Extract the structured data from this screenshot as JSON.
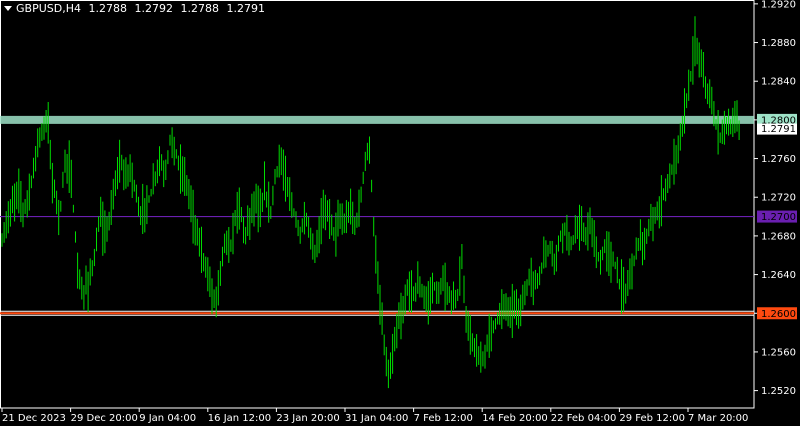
{
  "header": {
    "symbol_tf": "GBPUSD,H4",
    "open": "1.2788",
    "high": "1.2792",
    "low": "1.2788",
    "close": "1.2791"
  },
  "chart_data": {
    "type": "bar",
    "x_ticks": [
      "21 Dec 2023",
      "29 Dec 20:00",
      "9 Jan 04:00",
      "16 Jan 12:00",
      "23 Jan 20:00",
      "31 Jan 04:00",
      "7 Feb 12:00",
      "14 Feb 20:00",
      "22 Feb 04:00",
      "29 Feb 12:00",
      "7 Mar 20:00"
    ],
    "y_ticks": [
      1.292,
      1.288,
      1.284,
      1.28,
      1.276,
      1.272,
      1.268,
      1.264,
      1.26,
      1.256,
      1.252
    ],
    "ylim": [
      1.2502,
      1.2924
    ],
    "grid": false,
    "bar_color": "#00dd00",
    "current_price": "1.2791",
    "levels": [
      {
        "price": "1.2800",
        "color": "#9fe3c8",
        "label_bg": "#9fe3c8",
        "label_fg": "#000000"
      },
      {
        "price": "1.2700",
        "color": "#6a1fb0",
        "label_bg": "#6a1fb0",
        "label_fg": "#000000"
      },
      {
        "price": "1.2600",
        "color": "#ff4a10",
        "label_bg": "#ff4a10",
        "label_fg": "#000000"
      }
    ],
    "path_points": [
      [
        0,
        1.2665
      ],
      [
        7,
        1.2695
      ],
      [
        12,
        1.271
      ],
      [
        18,
        1.273
      ],
      [
        23,
        1.2705
      ],
      [
        28,
        1.272
      ],
      [
        33,
        1.2745
      ],
      [
        38,
        1.278
      ],
      [
        43,
        1.279
      ],
      [
        48,
        1.28
      ],
      [
        52,
        1.274
      ],
      [
        56,
        1.272
      ],
      [
        60,
        1.27
      ],
      [
        65,
        1.276
      ],
      [
        70,
        1.275
      ],
      [
        74,
        1.27
      ],
      [
        78,
        1.264
      ],
      [
        82,
        1.262
      ],
      [
        88,
        1.263
      ],
      [
        95,
        1.266
      ],
      [
        100,
        1.27
      ],
      [
        105,
        1.268
      ],
      [
        110,
        1.27
      ],
      [
        115,
        1.273
      ],
      [
        120,
        1.276
      ],
      [
        125,
        1.274
      ],
      [
        130,
        1.275
      ],
      [
        135,
        1.273
      ],
      [
        140,
        1.27
      ],
      [
        145,
        1.271
      ],
      [
        150,
        1.272
      ],
      [
        155,
        1.274
      ],
      [
        160,
        1.276
      ],
      [
        165,
        1.274
      ],
      [
        170,
        1.278
      ],
      [
        175,
        1.277
      ],
      [
        180,
        1.275
      ],
      [
        185,
        1.274
      ],
      [
        190,
        1.272
      ],
      [
        195,
        1.269
      ],
      [
        200,
        1.267
      ],
      [
        205,
        1.265
      ],
      [
        210,
        1.263
      ],
      [
        215,
        1.261
      ],
      [
        220,
        1.264
      ],
      [
        225,
        1.268
      ],
      [
        230,
        1.266
      ],
      [
        235,
        1.27
      ],
      [
        240,
        1.271
      ],
      [
        245,
        1.268
      ],
      [
        250,
        1.27
      ],
      [
        255,
        1.272
      ],
      [
        260,
        1.27
      ],
      [
        265,
        1.273
      ],
      [
        270,
        1.27
      ],
      [
        275,
        1.274
      ],
      [
        280,
        1.276
      ],
      [
        285,
        1.274
      ],
      [
        290,
        1.272
      ],
      [
        295,
        1.27
      ],
      [
        300,
        1.268
      ],
      [
        305,
        1.27
      ],
      [
        310,
        1.268
      ],
      [
        315,
        1.266
      ],
      [
        320,
        1.269
      ],
      [
        325,
        1.271
      ],
      [
        330,
        1.27
      ],
      [
        335,
        1.268
      ],
      [
        340,
        1.27
      ],
      [
        345,
        1.269
      ],
      [
        350,
        1.271
      ],
      [
        355,
        1.269
      ],
      [
        360,
        1.271
      ],
      [
        365,
        1.276
      ],
      [
        370,
        1.277
      ],
      [
        373,
        1.27
      ],
      [
        377,
        1.264
      ],
      [
        381,
        1.26
      ],
      [
        385,
        1.256
      ],
      [
        389,
        1.253
      ],
      [
        393,
        1.256
      ],
      [
        398,
        1.259
      ],
      [
        403,
        1.26
      ],
      [
        408,
        1.263
      ],
      [
        413,
        1.262
      ],
      [
        418,
        1.263
      ],
      [
        423,
        1.262
      ],
      [
        428,
        1.261
      ],
      [
        433,
        1.263
      ],
      [
        438,
        1.262
      ],
      [
        443,
        1.263
      ],
      [
        448,
        1.262
      ],
      [
        453,
        1.261
      ],
      [
        458,
        1.262
      ],
      [
        462,
        1.266
      ],
      [
        465,
        1.26
      ],
      [
        470,
        1.258
      ],
      [
        475,
        1.256
      ],
      [
        480,
        1.255
      ],
      [
        485,
        1.256
      ],
      [
        490,
        1.258
      ],
      [
        495,
        1.259
      ],
      [
        500,
        1.26
      ],
      [
        505,
        1.261
      ],
      [
        510,
        1.26
      ],
      [
        515,
        1.261
      ],
      [
        520,
        1.26
      ],
      [
        525,
        1.262
      ],
      [
        530,
        1.264
      ],
      [
        535,
        1.263
      ],
      [
        540,
        1.264
      ],
      [
        545,
        1.266
      ],
      [
        550,
        1.267
      ],
      [
        555,
        1.265
      ],
      [
        560,
        1.268
      ],
      [
        565,
        1.269
      ],
      [
        570,
        1.267
      ],
      [
        575,
        1.268
      ],
      [
        580,
        1.269
      ],
      [
        585,
        1.268
      ],
      [
        590,
        1.269
      ],
      [
        595,
        1.267
      ],
      [
        600,
        1.265
      ],
      [
        605,
        1.267
      ],
      [
        610,
        1.266
      ],
      [
        615,
        1.265
      ],
      [
        620,
        1.263
      ],
      [
        625,
        1.262
      ],
      [
        630,
        1.264
      ],
      [
        635,
        1.266
      ],
      [
        640,
        1.268
      ],
      [
        645,
        1.267
      ],
      [
        650,
        1.269
      ],
      [
        655,
        1.27
      ],
      [
        660,
        1.271
      ],
      [
        665,
        1.273
      ],
      [
        670,
        1.274
      ],
      [
        675,
        1.276
      ],
      [
        680,
        1.278
      ],
      [
        685,
        1.281
      ],
      [
        690,
        1.284
      ],
      [
        695,
        1.288
      ],
      [
        700,
        1.286
      ],
      [
        705,
        1.284
      ],
      [
        710,
        1.282
      ],
      [
        715,
        1.28
      ],
      [
        720,
        1.278
      ],
      [
        725,
        1.28
      ],
      [
        730,
        1.279
      ],
      [
        735,
        1.28
      ],
      [
        740,
        1.2791
      ]
    ]
  }
}
